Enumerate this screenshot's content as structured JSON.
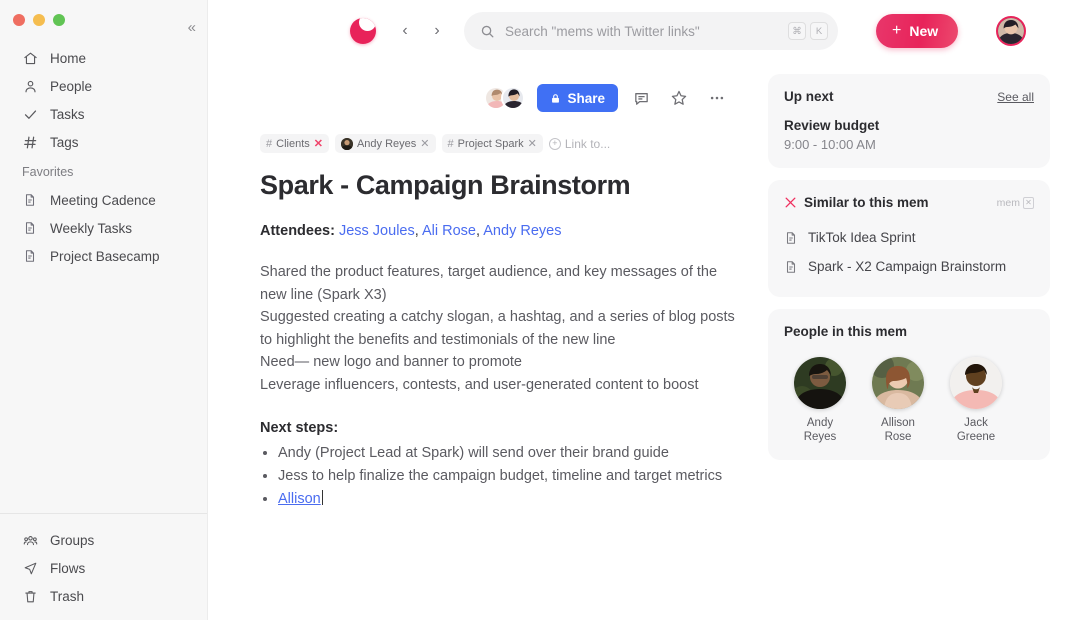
{
  "window": {
    "controls": [
      "close",
      "minimize",
      "zoom"
    ]
  },
  "sidebar": {
    "collapse_label": "«",
    "nav": [
      {
        "label": "Home",
        "icon": "home-icon"
      },
      {
        "label": "People",
        "icon": "person-icon"
      },
      {
        "label": "Tasks",
        "icon": "check-icon"
      },
      {
        "label": "Tags",
        "icon": "hash-icon"
      }
    ],
    "favorites_title": "Favorites",
    "favorites": [
      {
        "label": "Meeting Cadence",
        "icon": "document-icon"
      },
      {
        "label": "Weekly Tasks",
        "icon": "document-icon"
      },
      {
        "label": "Project Basecamp",
        "icon": "document-icon"
      }
    ],
    "bottom": [
      {
        "label": "Groups",
        "icon": "groups-icon"
      },
      {
        "label": "Flows",
        "icon": "flows-icon"
      },
      {
        "label": "Trash",
        "icon": "trash-icon"
      }
    ]
  },
  "topbar": {
    "brand_name": "mem-logo",
    "back_label": "‹",
    "forward_label": "›",
    "search": {
      "placeholder": "Search \"mems with Twitter links\"",
      "shortcut_keys": [
        "⌘",
        "K"
      ]
    },
    "new_button": {
      "plus": "+",
      "label": "New"
    },
    "profile_name": "user-avatar"
  },
  "doc": {
    "toolbar": {
      "share_label": "Share",
      "lock_icon": "lock-icon",
      "comment_icon": "comment-icon",
      "star_icon": "star-icon",
      "more_icon": "more-horizontal-icon"
    },
    "chips": [
      {
        "hash": "#",
        "label": "Clients",
        "remove": "✕",
        "remove_color": "#f0436a",
        "type": "tag"
      },
      {
        "label": "Andy Reyes",
        "remove": "✕",
        "type": "person"
      },
      {
        "hash": "#",
        "label": "Project Spark",
        "remove": "✕",
        "type": "tag"
      },
      {
        "label": "Link to...",
        "type": "action"
      }
    ],
    "title": "Spark - Campaign Brainstorm",
    "attendees_label": "Attendees:",
    "attendees": [
      "Jess Joules",
      "Ali Rose",
      "Andy Reyes"
    ],
    "body_lines": [
      "Shared the product features, target audience, and key messages of the",
      "new line (Spark X3)",
      "Suggested creating a catchy slogan, a hashtag, and a series of blog posts",
      "to highlight the benefits and testimonials of the new line",
      "Need— new logo and banner to promote",
      "Leverage influencers, contests, and user-generated content to boost"
    ],
    "next_steps_label": "Next steps:",
    "next_steps": [
      {
        "text": "Andy (Project Lead at Spark) will send over their brand guide"
      },
      {
        "text": "Jess to help finalize the campaign budget, timeline and target metrics"
      },
      {
        "mention": "Allison"
      }
    ]
  },
  "rail": {
    "up_next": {
      "title": "Up next",
      "see_all": "See all",
      "event_name": "Review budget",
      "event_time": "9:00 - 10:00 AM"
    },
    "similar": {
      "title": "Similar to this mem",
      "icon": "sparkle-icon",
      "badge_text": "mem",
      "badge_glyph": "✕",
      "items": [
        {
          "label": "TikTok Idea Sprint",
          "icon": "document-icon"
        },
        {
          "label": "Spark - X2 Campaign Brainstorm",
          "icon": "document-icon"
        }
      ]
    },
    "people": {
      "title": "People in this mem",
      "items": [
        {
          "first": "Andy",
          "last": "Reyes"
        },
        {
          "first": "Allison",
          "last": "Rose"
        },
        {
          "first": "Jack",
          "last": "Greene"
        }
      ]
    }
  },
  "colors": {
    "brand": "#e8235a",
    "share_blue": "#4070f4",
    "link_blue": "#4a6cf0",
    "sidebar_bg": "#f7f7f7",
    "card_bg": "#f7f7f8"
  }
}
